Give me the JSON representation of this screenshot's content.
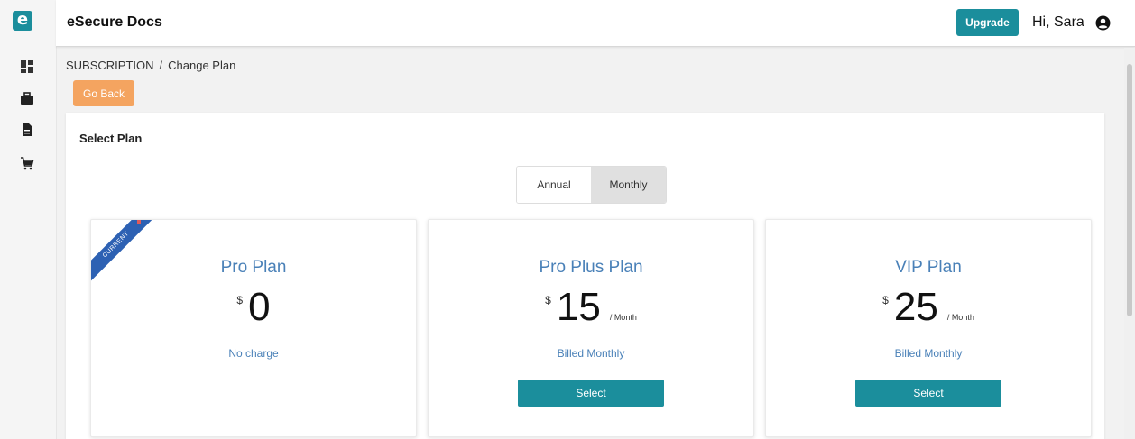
{
  "app": {
    "logo_letter": "e",
    "title": "eSecure Docs"
  },
  "header": {
    "upgrade_label": "Upgrade",
    "greeting": "Hi, Sara"
  },
  "sidebar": {
    "items": [
      {
        "icon": "dashboard-icon"
      },
      {
        "icon": "briefcase-icon"
      },
      {
        "icon": "document-icon"
      },
      {
        "icon": "cart-icon"
      }
    ]
  },
  "breadcrumb": {
    "root": "SUBSCRIPTION",
    "separator": "/",
    "current": "Change Plan"
  },
  "go_back_label": "Go Back",
  "section_title": "Select Plan",
  "billing_toggle": {
    "options": [
      "Annual",
      "Monthly"
    ],
    "selected": "Monthly"
  },
  "plans": [
    {
      "name": "Pro Plan",
      "currency": "$",
      "price": "0",
      "period": "",
      "billing": "No charge",
      "ribbon": "CURRENT",
      "has_select": false
    },
    {
      "name": "Pro Plus Plan",
      "currency": "$",
      "price": "15",
      "period": "/ Month",
      "billing": "Billed Monthly",
      "select_label": "Select",
      "has_select": true
    },
    {
      "name": "VIP Plan",
      "currency": "$",
      "price": "25",
      "period": "/ Month",
      "billing": "Billed Monthly",
      "select_label": "Select",
      "has_select": true
    }
  ],
  "colors": {
    "brand": "#1b8e9c",
    "go_back": "#f4a460",
    "plan_title": "#4a81b8",
    "ribbon": "#2d61b3"
  }
}
